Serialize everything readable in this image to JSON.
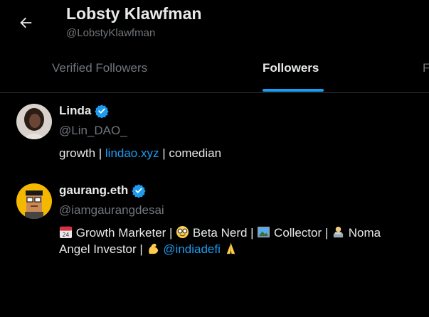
{
  "header": {
    "name": "Lobsty Klawfman",
    "handle": "@LobstyKlawfman"
  },
  "tabs": [
    {
      "label": "Verified Followers",
      "active": false
    },
    {
      "label": "Followers",
      "active": true
    },
    {
      "label": "F",
      "active": false
    }
  ],
  "users": [
    {
      "name": "Linda",
      "handle": "@Lin_DAO_",
      "verified": true,
      "bio_parts": [
        "growth | ",
        "lindao.xyz",
        " | comedian"
      ]
    },
    {
      "name": "gaurang.eth",
      "handle": "@iamgaurangdesai",
      "verified": true,
      "bio_line1": [
        " Growth Marketer | ",
        " Beta Nerd | ",
        " Collector | ",
        " Noma"
      ],
      "bio_line2": [
        "Angel Investor | ",
        " ",
        "@indiadefi",
        " "
      ]
    }
  ],
  "colors": {
    "background": "#000000",
    "accent": "#1d9bf0",
    "muted": "#71767b",
    "text": "#e7e9ea"
  }
}
